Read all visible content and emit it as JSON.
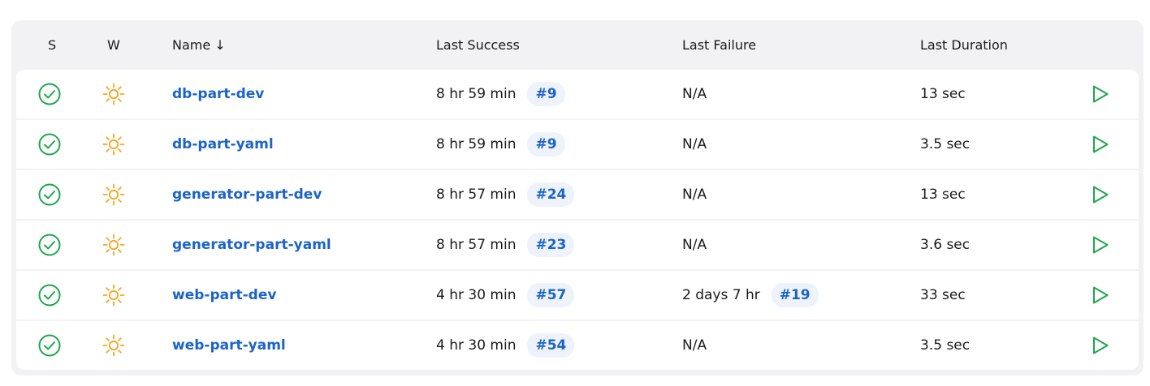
{
  "colors": {
    "success_green": "#1ea64c",
    "sunny_orange": "#f5a623",
    "link_blue": "#1a64c8",
    "badge_bg": "#eef3fb"
  },
  "header": {
    "status_label": "S",
    "weather_label": "W",
    "name_label": "Name  ↓",
    "last_success_label": "Last Success",
    "last_failure_label": "Last Failure",
    "last_duration_label": "Last Duration"
  },
  "rows": [
    {
      "status_icon": "success-check-icon",
      "weather_icon": "sunny-weather-icon",
      "name": "db-part-dev",
      "last_success": "8 hr 59 min",
      "success_build": "#9",
      "last_failure": "N/A",
      "failure_build": "",
      "last_duration": "13 sec",
      "action_icon": "run-build-icon"
    },
    {
      "status_icon": "success-check-icon",
      "weather_icon": "sunny-weather-icon",
      "name": "db-part-yaml",
      "last_success": "8 hr 59 min",
      "success_build": "#9",
      "last_failure": "N/A",
      "failure_build": "",
      "last_duration": "3.5 sec",
      "action_icon": "run-build-icon"
    },
    {
      "status_icon": "success-check-icon",
      "weather_icon": "sunny-weather-icon",
      "name": "generator-part-dev",
      "last_success": "8 hr 57 min",
      "success_build": "#24",
      "last_failure": "N/A",
      "failure_build": "",
      "last_duration": "13 sec",
      "action_icon": "run-build-icon"
    },
    {
      "status_icon": "success-check-icon",
      "weather_icon": "sunny-weather-icon",
      "name": "generator-part-yaml",
      "last_success": "8 hr 57 min",
      "success_build": "#23",
      "last_failure": "N/A",
      "failure_build": "",
      "last_duration": "3.6 sec",
      "action_icon": "run-build-icon"
    },
    {
      "status_icon": "success-check-icon",
      "weather_icon": "sunny-weather-icon",
      "name": "web-part-dev",
      "last_success": "4 hr 30 min",
      "success_build": "#57",
      "last_failure": "2 days 7 hr",
      "failure_build": "#19",
      "last_duration": "33 sec",
      "action_icon": "run-build-icon"
    },
    {
      "status_icon": "success-check-icon",
      "weather_icon": "sunny-weather-icon",
      "name": "web-part-yaml",
      "last_success": "4 hr 30 min",
      "success_build": "#54",
      "last_failure": "N/A",
      "failure_build": "",
      "last_duration": "3.5 sec",
      "action_icon": "run-build-icon"
    }
  ]
}
